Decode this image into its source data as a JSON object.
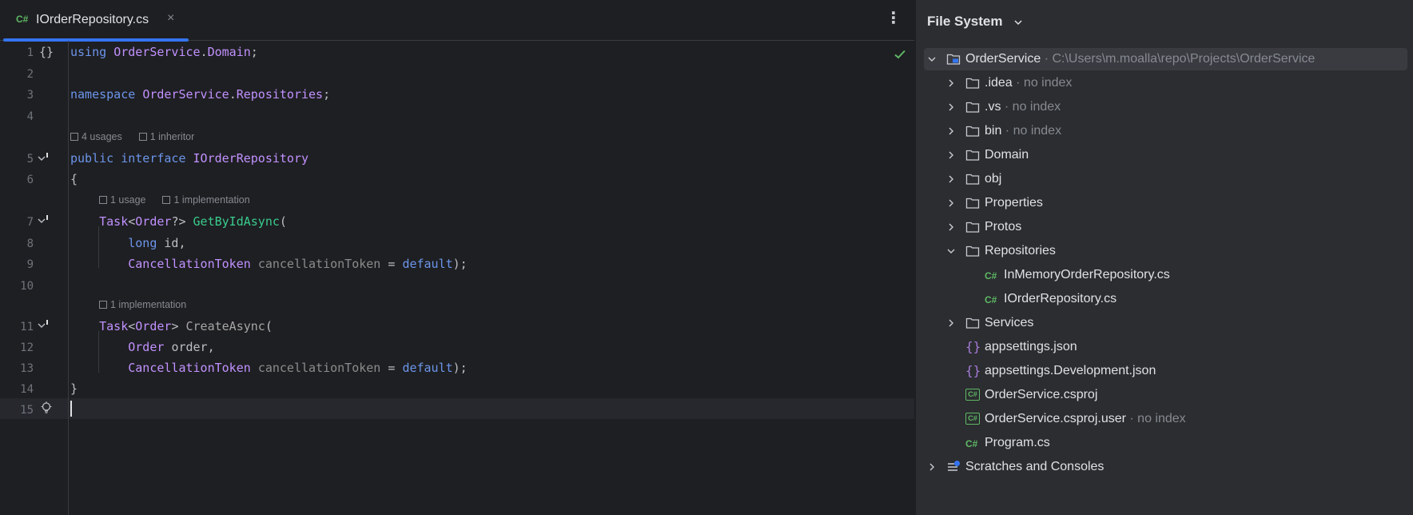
{
  "editor": {
    "tab": {
      "badge": "C#",
      "filename": "IOrderRepository.cs",
      "close": "×"
    },
    "menu": "⋮",
    "lines": [
      {
        "n": "1",
        "tokens": [
          [
            "kw2",
            "using "
          ],
          [
            "ns",
            "OrderService"
          ],
          [
            "",
            "."
          ],
          [
            "ns",
            "Domain"
          ],
          [
            "",
            ";"
          ]
        ]
      },
      {
        "n": "2",
        "tokens": []
      },
      {
        "n": "3",
        "tokens": [
          [
            "kw2",
            "namespace "
          ],
          [
            "ns",
            "OrderService"
          ],
          [
            "",
            "."
          ],
          [
            "ns",
            "Repositories"
          ],
          [
            "",
            ";"
          ]
        ]
      },
      {
        "n": "4",
        "tokens": []
      },
      {
        "n": "5",
        "tokens": [
          [
            "kw2",
            "public "
          ],
          [
            "kw2",
            "interface "
          ],
          [
            "ty",
            "IOrderRepository"
          ]
        ]
      },
      {
        "n": "6",
        "tokens": [
          [
            "",
            "{"
          ]
        ]
      },
      {
        "n": "7",
        "tokens": [
          [
            "",
            "    "
          ],
          [
            "ty",
            "Task"
          ],
          [
            "",
            "<"
          ],
          [
            "ty",
            "Order"
          ],
          [
            "",
            "?> "
          ],
          [
            "fn",
            "GetByIdAsync"
          ],
          [
            "",
            "("
          ]
        ]
      },
      {
        "n": "8",
        "tokens": [
          [
            "",
            "        "
          ],
          [
            "kw2",
            "long "
          ],
          [
            "",
            "id,"
          ]
        ]
      },
      {
        "n": "9",
        "tokens": [
          [
            "",
            "        "
          ],
          [
            "ty",
            "CancellationToken "
          ],
          [
            "gray",
            "cancellationToken "
          ],
          [
            "",
            "= "
          ],
          [
            "kw2",
            "default"
          ],
          [
            "",
            ");"
          ]
        ]
      },
      {
        "n": "10",
        "tokens": []
      },
      {
        "n": "11",
        "tokens": [
          [
            "",
            "    "
          ],
          [
            "ty",
            "Task"
          ],
          [
            "",
            "<"
          ],
          [
            "ty",
            "Order"
          ],
          [
            "",
            "> "
          ],
          [
            "fnd",
            "CreateAsync"
          ],
          [
            "",
            "("
          ]
        ]
      },
      {
        "n": "12",
        "tokens": [
          [
            "",
            "        "
          ],
          [
            "ty",
            "Order "
          ],
          [
            "",
            "order,"
          ]
        ]
      },
      {
        "n": "13",
        "tokens": [
          [
            "",
            "        "
          ],
          [
            "ty",
            "CancellationToken "
          ],
          [
            "gray",
            "cancellationToken "
          ],
          [
            "",
            "= "
          ],
          [
            "kw2",
            "default"
          ],
          [
            "",
            ");"
          ]
        ]
      },
      {
        "n": "14",
        "tokens": [
          [
            "",
            "}"
          ]
        ]
      },
      {
        "n": "15",
        "tokens": []
      }
    ],
    "gutter_brace": "{}",
    "hints": {
      "interface_usages": "4 usages",
      "interface_inheritor": "1 inheritor",
      "getbyid_usage": "1 usage",
      "getbyid_impl": "1 implementation",
      "create_impl": "1 implementation"
    }
  },
  "panel": {
    "title": "File System",
    "tree": [
      {
        "name": "OrderService",
        "extra": " · C:\\Users\\m.moalla\\repo\\Projects\\OrderService",
        "level": 0,
        "arrow": "down",
        "icon": "project-folder-icon",
        "selected": true
      },
      {
        "name": ".idea",
        "extra": " · no index",
        "level": 1,
        "arrow": "right",
        "icon": "folder-icon"
      },
      {
        "name": ".vs",
        "extra": " · no index",
        "level": 1,
        "arrow": "right",
        "icon": "folder-icon"
      },
      {
        "name": "bin",
        "extra": " · no index",
        "level": 1,
        "arrow": "right",
        "icon": "folder-icon"
      },
      {
        "name": "Domain",
        "extra": "",
        "level": 1,
        "arrow": "right",
        "icon": "folder-icon"
      },
      {
        "name": "obj",
        "extra": "",
        "level": 1,
        "arrow": "right",
        "icon": "folder-icon"
      },
      {
        "name": "Properties",
        "extra": "",
        "level": 1,
        "arrow": "right",
        "icon": "folder-icon"
      },
      {
        "name": "Protos",
        "extra": "",
        "level": 1,
        "arrow": "right",
        "icon": "folder-icon"
      },
      {
        "name": "Repositories",
        "extra": "",
        "level": 1,
        "arrow": "down",
        "icon": "folder-icon"
      },
      {
        "name": "InMemoryOrderRepository.cs",
        "extra": "",
        "level": 2,
        "arrow": "",
        "icon": "csharp-file-icon"
      },
      {
        "name": "IOrderRepository.cs",
        "extra": "",
        "level": 2,
        "arrow": "",
        "icon": "csharp-file-icon"
      },
      {
        "name": "Services",
        "extra": "",
        "level": 1,
        "arrow": "right",
        "icon": "folder-icon"
      },
      {
        "name": "appsettings.json",
        "extra": "",
        "level": 1,
        "arrow": "",
        "icon": "json-file-icon"
      },
      {
        "name": "appsettings.Development.json",
        "extra": "",
        "level": 1,
        "arrow": "",
        "icon": "json-file-icon"
      },
      {
        "name": "OrderService.csproj",
        "extra": "",
        "level": 1,
        "arrow": "",
        "icon": "csproj-file-icon"
      },
      {
        "name": "OrderService.csproj.user",
        "extra": " · no index",
        "level": 1,
        "arrow": "",
        "icon": "csproj-file-icon"
      },
      {
        "name": "Program.cs",
        "extra": "",
        "level": 1,
        "arrow": "",
        "icon": "csharp-file-icon"
      },
      {
        "name": "Scratches and Consoles",
        "extra": "",
        "level": 0,
        "arrow": "right",
        "icon": "scratches-icon"
      }
    ],
    "badges": {
      "cs": "C#",
      "csproj": "C#",
      "json": "{}"
    }
  }
}
